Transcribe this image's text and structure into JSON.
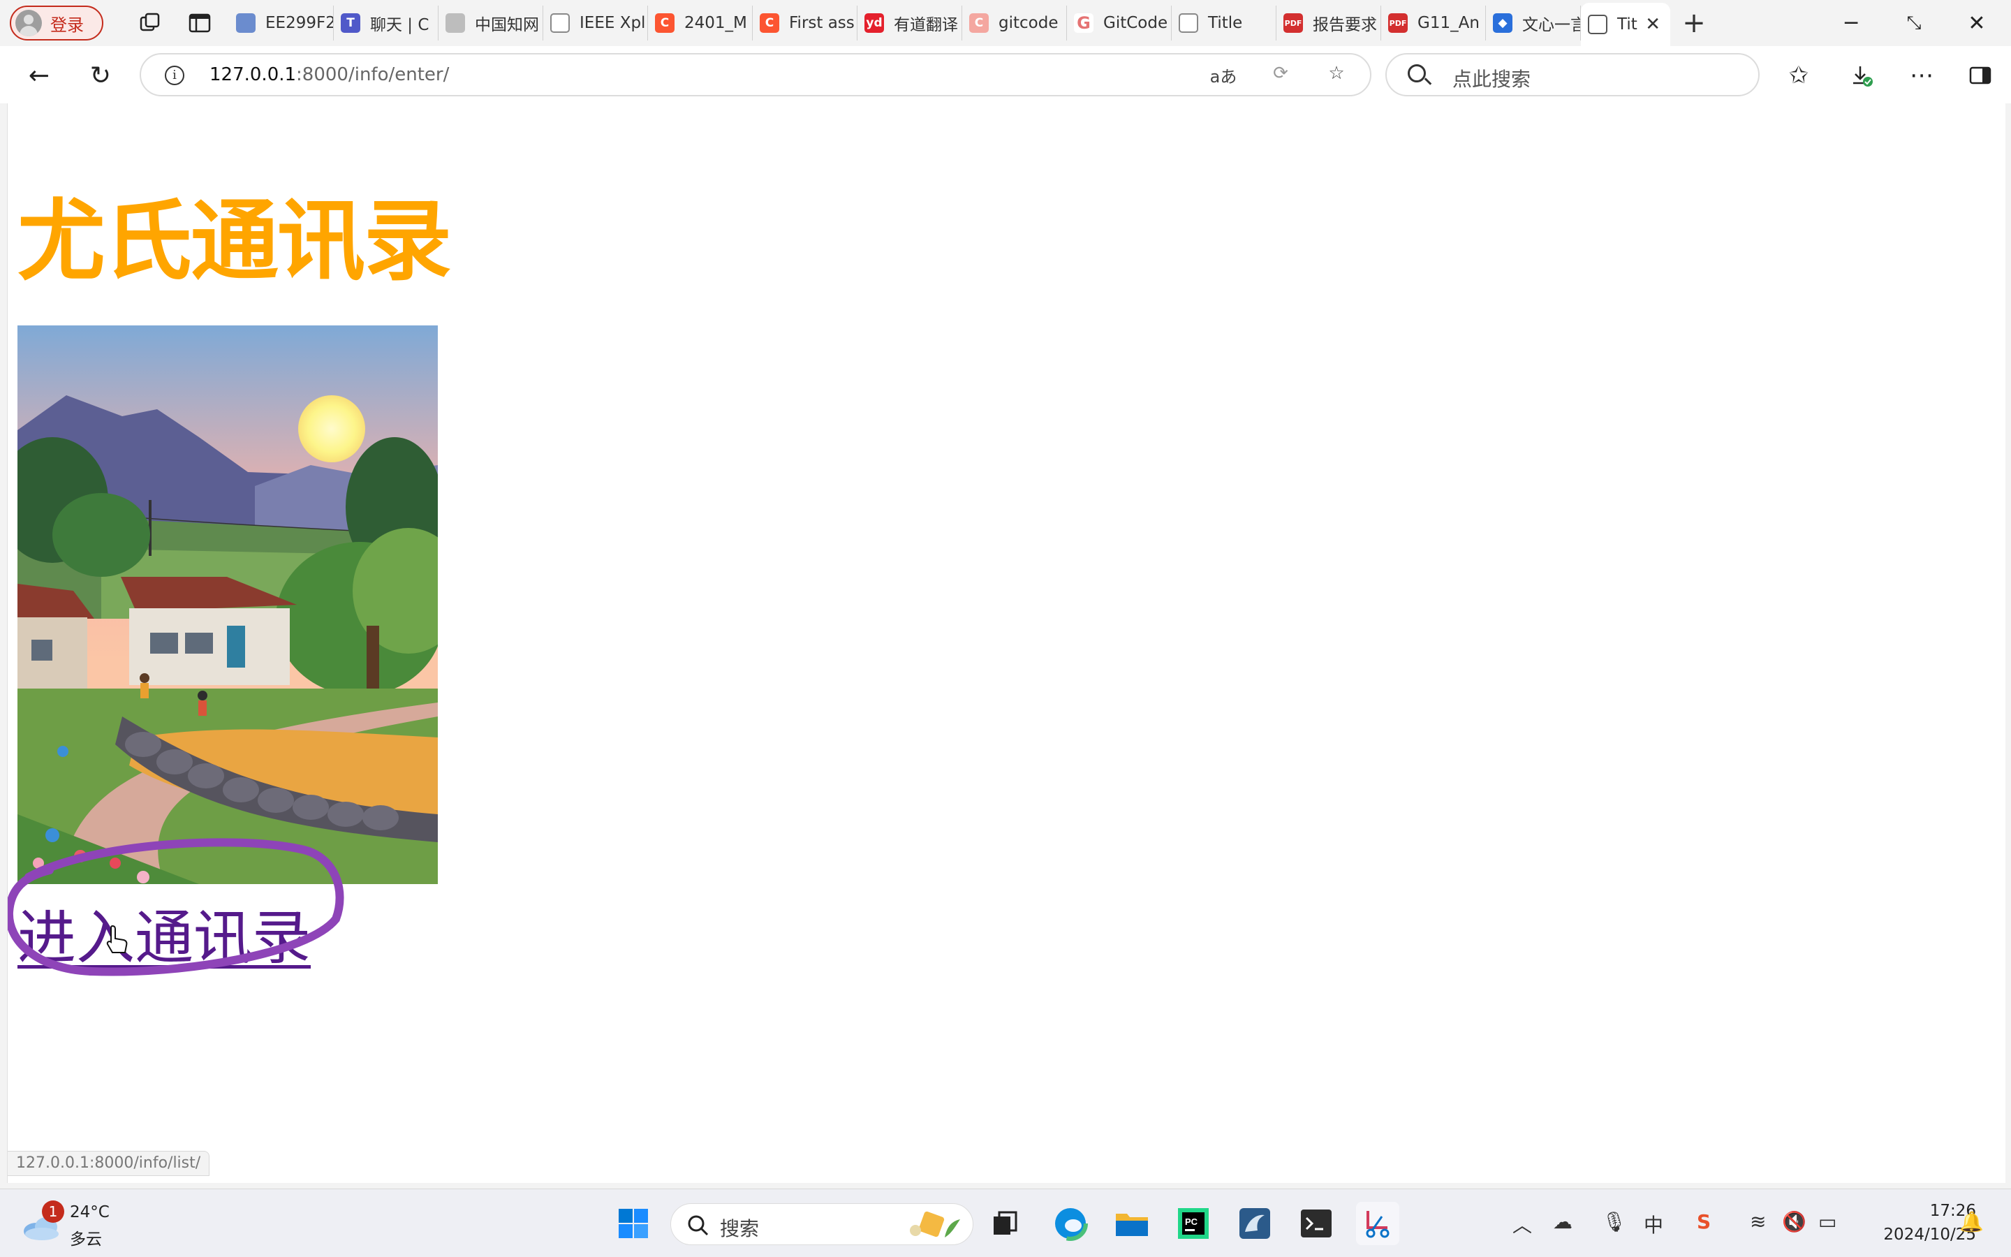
{
  "browser": {
    "profile_label": "登录",
    "tabs": [
      {
        "label": "EE299F2",
        "icon": "image-tab-icon",
        "color": "#6b8cce"
      },
      {
        "label": "聊天 | C",
        "icon": "teams-icon",
        "color": "#5059c9"
      },
      {
        "label": "中国知网",
        "icon": "cnki-icon",
        "color": "#888888"
      },
      {
        "label": "IEEE Xpl",
        "icon": "page-icon",
        "color": "#ffffff"
      },
      {
        "label": "2401_M",
        "icon": "csdn-icon",
        "color": "#fc5531"
      },
      {
        "label": "First ass",
        "icon": "csdn-icon",
        "color": "#fc5531"
      },
      {
        "label": "有道翻译",
        "icon": "youdao-icon",
        "color": "#e4202c"
      },
      {
        "label": "gitcode",
        "icon": "csdn-icon",
        "color": "#f4a7a0"
      },
      {
        "label": "GitCode",
        "icon": "gitcode-icon",
        "color": "#e57373"
      },
      {
        "label": "Title",
        "icon": "page-icon",
        "color": "#ffffff"
      },
      {
        "label": "报告要求",
        "icon": "pdf-icon",
        "color": "#d32f2f"
      },
      {
        "label": "G11_An",
        "icon": "pdf-icon",
        "color": "#d32f2f"
      },
      {
        "label": "文心一言",
        "icon": "wenxin-icon",
        "color": "#2a6fdb"
      }
    ],
    "active_tab": {
      "label": "Tit",
      "icon": "page-icon"
    },
    "address": {
      "host": "127.0.0.1",
      "rest": ":8000/info/enter/"
    },
    "search_placeholder": "点此搜索",
    "status_url": "127.0.0.1:8000/info/list/"
  },
  "page": {
    "title": "尤氏通讯录",
    "image_alt": "illustration-village-sunset",
    "link_text": "进入通讯录",
    "link_color": "#551a8b",
    "title_color": "#ffa500"
  },
  "taskbar": {
    "weather_badge": "1",
    "temperature": "24°C",
    "condition": "多云",
    "search_placeholder": "搜索",
    "ime_label": "中",
    "time": "17:26",
    "date": "2024/10/25"
  }
}
